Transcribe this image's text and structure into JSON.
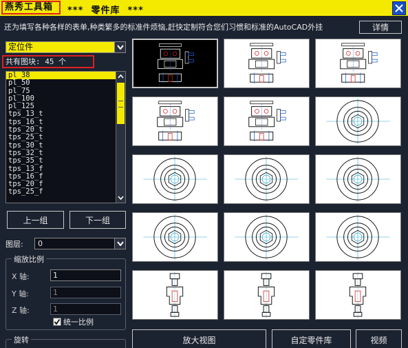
{
  "titlebar": {
    "app_name": "燕秀工具箱",
    "subtitle": "***  零件库  ***"
  },
  "info_text": "还为填写各种各样的表单,种类繁多的标准件烦恼,赶快定制符合您们习惯和标准的AutoCAD外挂",
  "buttons": {
    "details": "详情",
    "prev_group": "上一组",
    "next_group": "下一组",
    "zoom_view": "放大视图",
    "custom_part": "自定零件库",
    "video": "视频"
  },
  "category": {
    "selected": "定位件"
  },
  "block_count_text": "共有图块: 45 个",
  "blocks": [
    "pl_38",
    "pl_50",
    "pl_75",
    "pl_100",
    "pl_125",
    "tps_13_t",
    "tps_16_t",
    "tps_20_t",
    "tps_25_t",
    "tps_30_t",
    "tps_32_t",
    "tps_35_t",
    "tps_13_f",
    "tps_16_f",
    "tps_20_f",
    "tps_25_f"
  ],
  "selected_block": "pl_38",
  "layer": {
    "label": "图层:",
    "value": "0"
  },
  "scale": {
    "title": "缩放比例",
    "x_label": "X 轴:",
    "x_value": "1",
    "y_label": "Y 轴:",
    "y_value": "1",
    "z_label": "Z 轴:",
    "z_value": "1",
    "uniform_label": "统一比例",
    "uniform_checked": true
  },
  "rotate": {
    "title": "旋转"
  },
  "thumbnails": [
    "plate",
    "plate",
    "plate",
    "plate",
    "plate",
    "circle",
    "circle",
    "circle",
    "circle",
    "circle",
    "circle",
    "circle",
    "pin",
    "pin",
    "pin"
  ],
  "colors": {
    "accent": "#f4ea00",
    "background": "#1b2230",
    "highlight_box": "#e02020",
    "close_button": "#1a4fc4"
  }
}
